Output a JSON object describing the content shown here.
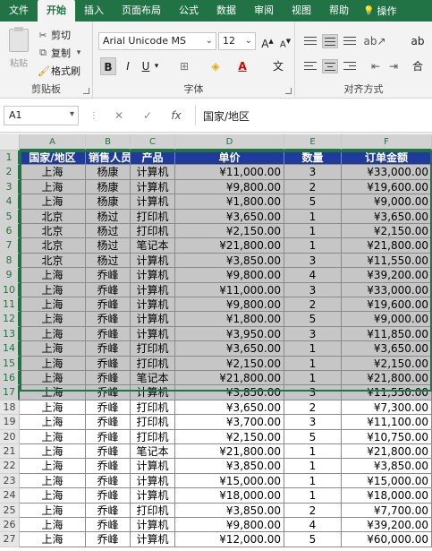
{
  "tabs": [
    "文件",
    "开始",
    "插入",
    "页面布局",
    "公式",
    "数据",
    "审阅",
    "视图",
    "帮助",
    "操作"
  ],
  "active_tab": "开始",
  "clipboard": {
    "paste": "粘贴",
    "cut": "剪切",
    "copy": "复制",
    "format_painter": "格式刷",
    "group_label": "剪贴板"
  },
  "font": {
    "name": "Arial Unicode MS",
    "size": "12",
    "group_label": "字体",
    "bold": "B",
    "italic": "I",
    "underline": "U",
    "underline_arrow": "▾",
    "grow": "A",
    "shrink": "A",
    "color_letter": "A",
    "wen": "文",
    "fill_icon": "◈",
    "border_icon": "⊞"
  },
  "alignment": {
    "group_label": "对齐方式",
    "wrap": "ab",
    "merge": "合"
  },
  "formula_bar": {
    "name_box": "A1",
    "cancel": "✕",
    "confirm": "✓",
    "fx": "fx",
    "formula": "国家/地区"
  },
  "columns": [
    "A",
    "B",
    "C",
    "D",
    "E",
    "F"
  ],
  "header_row": [
    "国家/地区",
    "销售人员",
    "产品",
    "单价",
    "数量",
    "订单金额"
  ],
  "rows": [
    [
      "2",
      "上海",
      "杨康",
      "计算机",
      "¥11,000.00",
      "3",
      "¥33,000.00"
    ],
    [
      "3",
      "上海",
      "杨康",
      "计算机",
      "¥9,800.00",
      "2",
      "¥19,600.00"
    ],
    [
      "4",
      "上海",
      "杨康",
      "计算机",
      "¥1,800.00",
      "5",
      "¥9,000.00"
    ],
    [
      "5",
      "北京",
      "杨过",
      "打印机",
      "¥3,650.00",
      "1",
      "¥3,650.00"
    ],
    [
      "6",
      "北京",
      "杨过",
      "打印机",
      "¥2,150.00",
      "1",
      "¥2,150.00"
    ],
    [
      "7",
      "北京",
      "杨过",
      "笔记本",
      "¥21,800.00",
      "1",
      "¥21,800.00"
    ],
    [
      "8",
      "北京",
      "杨过",
      "计算机",
      "¥3,850.00",
      "3",
      "¥11,550.00"
    ],
    [
      "9",
      "上海",
      "乔峰",
      "计算机",
      "¥9,800.00",
      "4",
      "¥39,200.00"
    ],
    [
      "10",
      "上海",
      "乔峰",
      "计算机",
      "¥11,000.00",
      "3",
      "¥33,000.00"
    ],
    [
      "11",
      "上海",
      "乔峰",
      "计算机",
      "¥9,800.00",
      "2",
      "¥19,600.00"
    ],
    [
      "12",
      "上海",
      "乔峰",
      "计算机",
      "¥1,800.00",
      "5",
      "¥9,000.00"
    ],
    [
      "13",
      "上海",
      "乔峰",
      "计算机",
      "¥3,950.00",
      "3",
      "¥11,850.00"
    ],
    [
      "14",
      "上海",
      "乔峰",
      "打印机",
      "¥3,650.00",
      "1",
      "¥3,650.00"
    ],
    [
      "15",
      "上海",
      "乔峰",
      "打印机",
      "¥2,150.00",
      "1",
      "¥2,150.00"
    ],
    [
      "16",
      "上海",
      "乔峰",
      "笔记本",
      "¥21,800.00",
      "1",
      "¥21,800.00"
    ],
    [
      "17",
      "上海",
      "乔峰",
      "计算机",
      "¥3,850.00",
      "3",
      "¥11,550.00"
    ],
    [
      "18",
      "上海",
      "乔峰",
      "打印机",
      "¥3,650.00",
      "2",
      "¥7,300.00"
    ],
    [
      "19",
      "上海",
      "乔峰",
      "打印机",
      "¥3,700.00",
      "3",
      "¥11,100.00"
    ],
    [
      "20",
      "上海",
      "乔峰",
      "打印机",
      "¥2,150.00",
      "5",
      "¥10,750.00"
    ],
    [
      "21",
      "上海",
      "乔峰",
      "笔记本",
      "¥21,800.00",
      "1",
      "¥21,800.00"
    ],
    [
      "22",
      "上海",
      "乔峰",
      "计算机",
      "¥3,850.00",
      "1",
      "¥3,850.00"
    ],
    [
      "23",
      "上海",
      "乔峰",
      "计算机",
      "¥15,000.00",
      "1",
      "¥15,000.00"
    ],
    [
      "24",
      "上海",
      "乔峰",
      "计算机",
      "¥18,000.00",
      "1",
      "¥18,000.00"
    ],
    [
      "25",
      "上海",
      "乔峰",
      "打印机",
      "¥3,850.00",
      "2",
      "¥7,700.00"
    ],
    [
      "26",
      "上海",
      "乔峰",
      "计算机",
      "¥9,800.00",
      "4",
      "¥39,200.00"
    ],
    [
      "27",
      "上海",
      "乔峰",
      "计算机",
      "¥12,000.00",
      "5",
      "¥60,000.00"
    ]
  ],
  "selected_through_row": 17,
  "colors": {
    "excel_green": "#217346",
    "header_fill": "#1f3a9a",
    "selection_fill": "#c6c6c6"
  }
}
